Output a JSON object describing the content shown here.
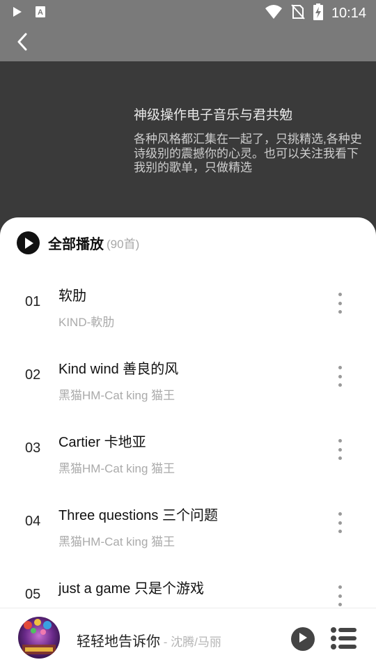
{
  "status_bar": {
    "time": "10:14",
    "icons": [
      "play-icon",
      "text-a-icon",
      "wifi-icon",
      "no-sim-icon",
      "battery-charging-icon"
    ]
  },
  "header": {
    "title": "神级操作电子音乐与君共勉",
    "description": "各种风格都汇集在一起了，只挑精选,各种史诗级别的震撼你的心灵。也可以关注我看下我别的歌单，只做精选"
  },
  "play_all": {
    "label": "全部播放",
    "count": "(90首)"
  },
  "songs": [
    {
      "index": "01",
      "title": "软肋",
      "artist": "KIND-軟肋"
    },
    {
      "index": "02",
      "title": "Kind wind 善良的风",
      "artist": "黑猫HM-Cat king 猫王"
    },
    {
      "index": "03",
      "title": "Cartier 卡地亚",
      "artist": "黑猫HM-Cat king 猫王"
    },
    {
      "index": "04",
      "title": "Three questions 三个问题",
      "artist": "黑猫HM-Cat king 猫王"
    },
    {
      "index": "05",
      "title": "just a game 只是个游戏",
      "artist": ""
    }
  ],
  "now_playing": {
    "title": "轻轻地告诉你",
    "separator": " - ",
    "artist": "沈腾/马丽"
  },
  "colors": {
    "status_bar": "#7a7a7a",
    "header_bg": "#3a3a3a",
    "sheet_bg": "#ffffff",
    "secondary_text": "#aaaaaa"
  }
}
